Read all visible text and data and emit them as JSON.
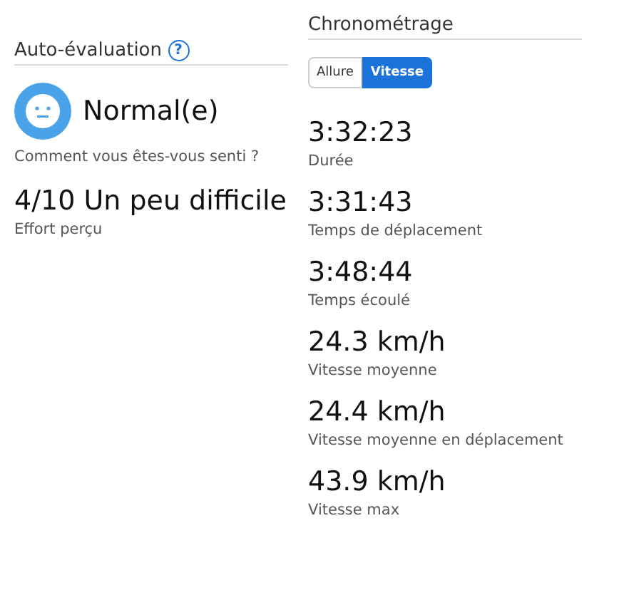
{
  "self_evaluation": {
    "title": "Auto-évaluation",
    "help_icon": "?",
    "feeling": "Normal(e)",
    "feeling_label": "Comment vous êtes-vous senti ?",
    "effort": "4/10 Un peu difficile",
    "effort_label": "Effort perçu"
  },
  "timing": {
    "title": "Chronométrage",
    "tabs": [
      {
        "label": "Allure",
        "selected": false
      },
      {
        "label": "Vitesse",
        "selected": true
      }
    ],
    "stats": [
      {
        "value": "3:32:23",
        "label": "Durée"
      },
      {
        "value": "3:31:43",
        "label": "Temps de déplacement"
      },
      {
        "value": "3:48:44",
        "label": "Temps écoulé"
      },
      {
        "value": "24.3 km/h",
        "label": "Vitesse moyenne"
      },
      {
        "value": "24.4 km/h",
        "label": "Vitesse moyenne en déplacement"
      },
      {
        "value": "43.9 km/h",
        "label": "Vitesse max"
      }
    ]
  }
}
